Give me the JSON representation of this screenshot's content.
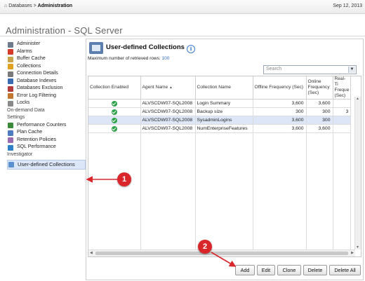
{
  "topbar": {
    "home_glyph": "⌂",
    "crumb_db": "Databases",
    "separator": ">",
    "crumb_admin": "Administration",
    "date": "Sep 12, 2013"
  },
  "page": {
    "title": "Administration - SQL Server"
  },
  "sidebar": {
    "items": [
      {
        "label": "Administer",
        "icon": "administer-icon",
        "cls": "adm"
      },
      {
        "label": "Alarms",
        "icon": "alarms-icon",
        "cls": "alr"
      },
      {
        "label": "Buffer Cache",
        "icon": "buffer-cache-icon",
        "cls": "buf"
      },
      {
        "label": "Collections",
        "icon": "collections-icon",
        "cls": "col"
      },
      {
        "label": "Connection Details",
        "icon": "connection-details-icon",
        "cls": "con"
      },
      {
        "label": "Database Indexes",
        "icon": "database-indexes-icon",
        "cls": "dbi"
      },
      {
        "label": "Databases Exclusion",
        "icon": "databases-exclusion-icon",
        "cls": "dbe"
      },
      {
        "label": "Error Log Filtering",
        "icon": "error-log-icon",
        "cls": "err"
      },
      {
        "label": "Locks",
        "icon": "locks-icon",
        "cls": "lck"
      },
      {
        "label": "On-demand Data",
        "icon": null,
        "cls": ""
      },
      {
        "label": "Settings",
        "icon": null,
        "cls": ""
      },
      {
        "label": "Performance Counters",
        "icon": "performance-counters-icon",
        "cls": "perf"
      },
      {
        "label": "Plan Cache",
        "icon": "plan-cache-icon",
        "cls": "plan"
      },
      {
        "label": "Retention Policies",
        "icon": "retention-policies-icon",
        "cls": "ret"
      },
      {
        "label": "SQL Performance",
        "icon": "sql-performance-icon",
        "cls": "sqlp"
      },
      {
        "label": "Investigator",
        "icon": null,
        "cls": ""
      },
      {
        "label": "User-defined Collections",
        "icon": "user-defined-collections-icon",
        "cls": "udc",
        "active": true
      }
    ]
  },
  "panel": {
    "title": "User-defined Collections",
    "info_glyph": "i",
    "max_rows_label": "Maximum number of retrieved rows:",
    "max_rows_value": "100",
    "search_placeholder": "Search",
    "search_dropdown_glyph": "▼"
  },
  "table": {
    "columns": [
      "Collection Enabled",
      "Agent Name",
      "Collection Name",
      "Offline Frequency (Sec)",
      "Online Frequency (Sec)",
      "Real-Ti Freque (Sec)"
    ],
    "sort_glyph": "▲",
    "rows": [
      {
        "enabled": true,
        "agent": "ALVSCDW07-SQL2008",
        "name": "Login Summary",
        "offline": "3,600",
        "online": "3,600",
        "real": "",
        "selected": false
      },
      {
        "enabled": true,
        "agent": "ALVSCDW07-SQL2008",
        "name": "Backup size",
        "offline": "300",
        "online": "300",
        "real": "3",
        "selected": false
      },
      {
        "enabled": true,
        "agent": "ALVSCDW07-SQL2008",
        "name": "SysadminLogins",
        "offline": "3,600",
        "online": "300",
        "real": "",
        "selected": true
      },
      {
        "enabled": true,
        "agent": "ALVSCDW07-SQL2008",
        "name": "NumEnterpriseFeatures",
        "offline": "3,600",
        "online": "3,600",
        "real": "",
        "selected": false
      }
    ]
  },
  "buttons": {
    "add": "Add",
    "edit": "Edit",
    "clone": "Clone",
    "delete": "Delete",
    "delete_all": "Delete All"
  },
  "callouts": {
    "one": "1",
    "two": "2",
    "color": "#d9262b"
  },
  "scroll": {
    "left_glyph": "◀",
    "right_glyph": "▶",
    "up_glyph": "▲",
    "down_glyph": "▼"
  }
}
